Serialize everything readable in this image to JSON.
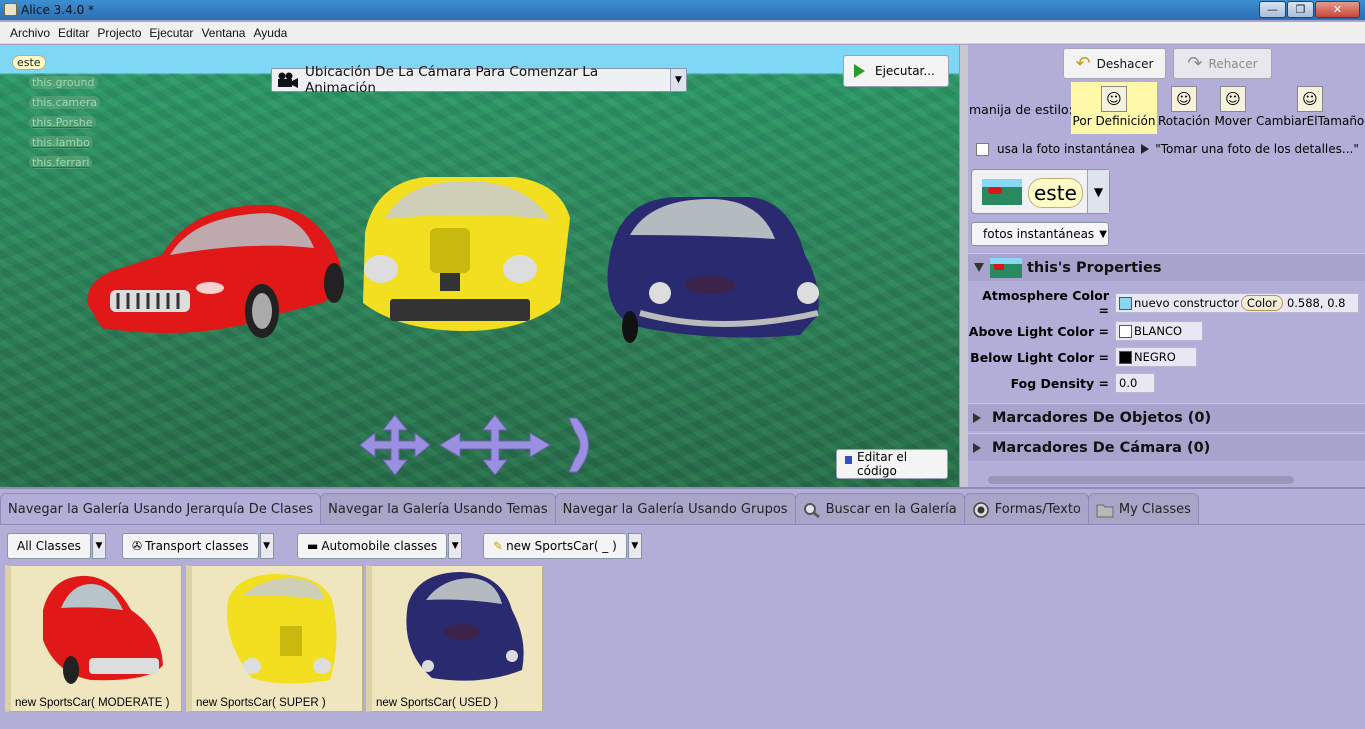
{
  "window": {
    "title": "Alice 3.4.0  *",
    "min": "—",
    "max": "❐",
    "close": "✕"
  },
  "menu": [
    "Archivo",
    "Editar",
    "Projecto",
    "Ejecutar",
    "Ventana",
    "Ayuda"
  ],
  "scene": {
    "tree_root": "este",
    "tree_items": [
      "this.ground",
      "this.camera",
      "this.Porshe",
      "this.lambo",
      "this.ferrari"
    ],
    "camera_marker": "Ubicación De La Cámara Para Comenzar La Animación",
    "run_label": "Ejecutar...",
    "edit_code_label": "Editar el código",
    "car_colors": {
      "left": "#e01818",
      "middle": "#f2e020",
      "right": "#2a2a70"
    }
  },
  "right_panel": {
    "undo": "Deshacer",
    "redo": "Rehacer",
    "style_label": "manija de estilo:",
    "styles": [
      "Por Definición",
      "Rotación",
      "Mover",
      "CambiarElTamaño"
    ],
    "selected_style": "Por Definición",
    "snapshot_checkbox_label": "usa la foto instantánea",
    "snapshot_hint": "\"Tomar una foto de los detalles...\"",
    "selected_object": "este",
    "snapshots_button": "fotos instantáneas",
    "properties_title": "this's Properties",
    "properties": {
      "atmosphere_label": "Atmosphere Color =",
      "atmosphere_constructor": "nuevo constructor",
      "atmosphere_type": "Color",
      "atmosphere_v1": "0.588",
      "atmosphere_v2": "0.8",
      "atmosphere_swatch": "#8ad6f0",
      "above_label": "Above Light Color =",
      "above_value": "BLANCO",
      "above_swatch": "#ffffff",
      "below_label": "Below Light Color =",
      "below_value": "NEGRO",
      "below_swatch": "#000000",
      "fog_label": "Fog Density =",
      "fog_value": "0.0"
    },
    "object_markers": "Marcadores De Objetos (0)",
    "camera_markers": "Marcadores De Cámara (0)"
  },
  "gallery": {
    "tabs": [
      "Navegar la Galería Usando Jerarquía De Clases",
      "Navegar la Galería Usando Temas",
      "Navegar la Galería Usando Grupos",
      "Buscar en la Galería",
      "Formas/Texto",
      "My Classes"
    ],
    "breadcrumb": [
      "All Classes",
      "Transport classes",
      "Automobile classes",
      "new SportsCar( _ )"
    ],
    "items": [
      "new SportsCar( MODERATE )",
      "new SportsCar( SUPER )",
      "new SportsCar( USED )"
    ]
  }
}
